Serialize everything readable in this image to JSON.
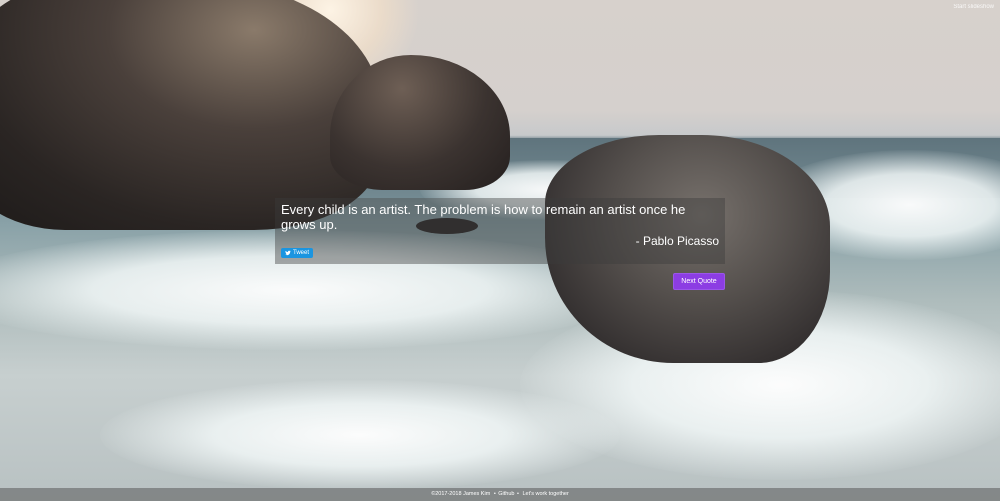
{
  "top_link": {
    "label": "Start slideshow"
  },
  "quote": {
    "text": "Every child is an artist. The problem is how to remain an artist once he grows up.",
    "author": "- Pablo Picasso"
  },
  "tweet_button": {
    "label": "Tweet",
    "icon": "twitter-bird-icon",
    "color": "#1b95e0"
  },
  "next_button": {
    "label": "Next Quote",
    "color": "#8c3de3"
  },
  "footer": {
    "copyright": "©2017-2018 James Kim",
    "sep1": "•",
    "github": "Github",
    "sep2": "•",
    "tagline": "Let's work together"
  }
}
